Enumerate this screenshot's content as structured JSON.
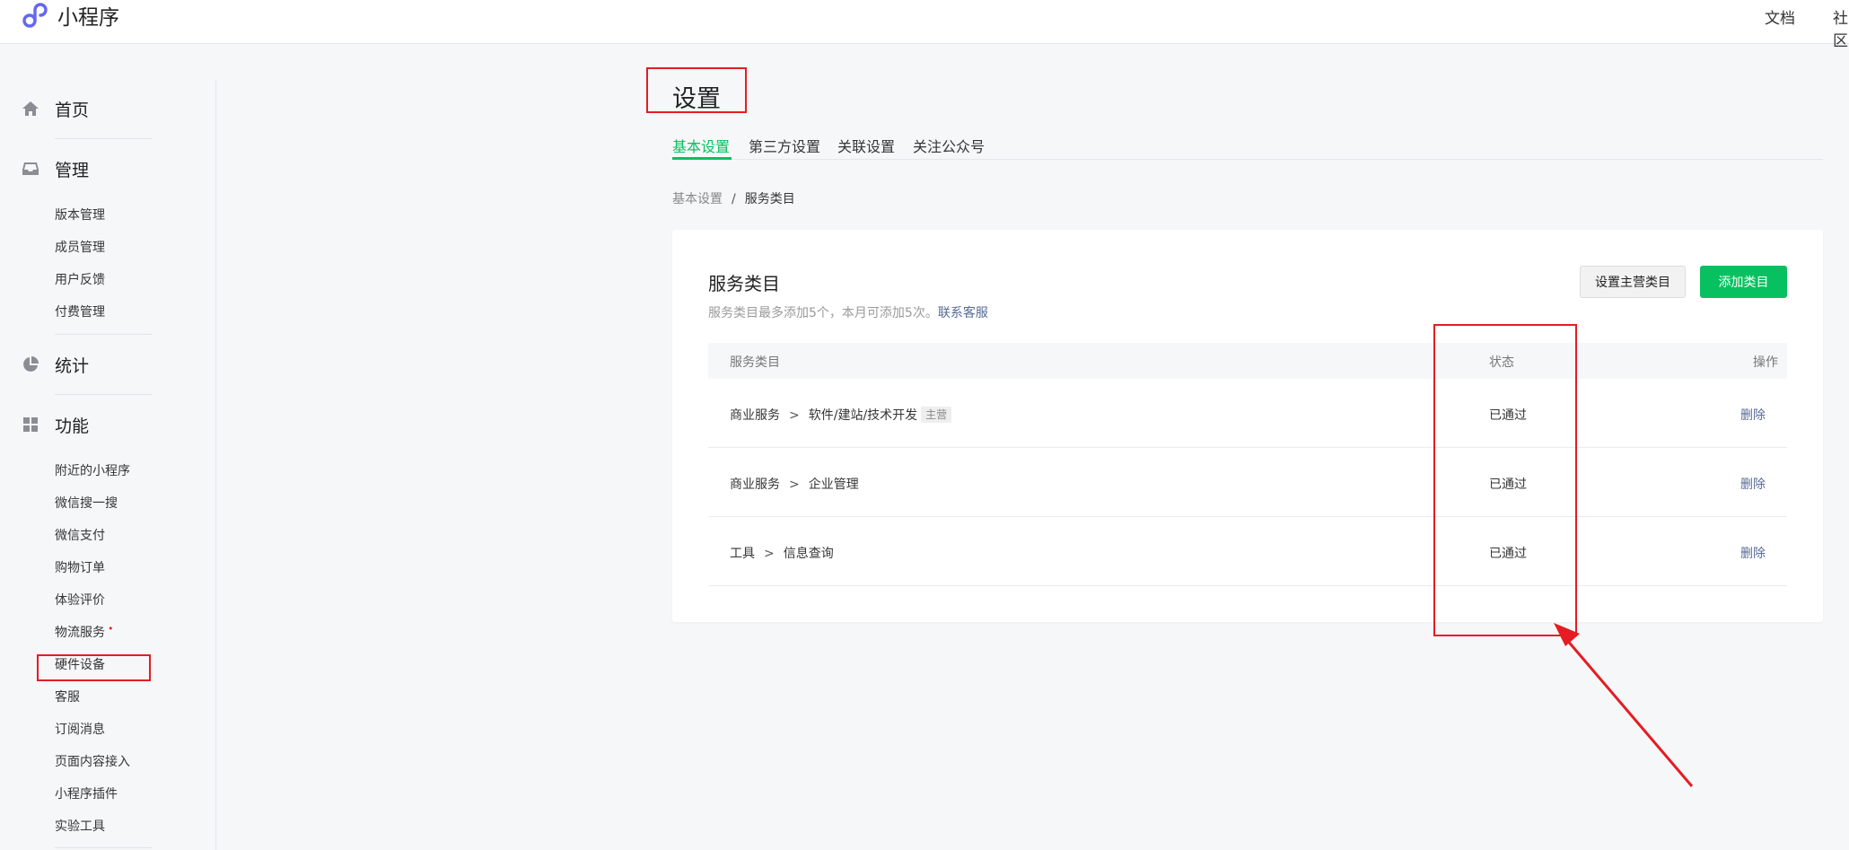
{
  "app": {
    "name": "小程序",
    "logo_icon": "mini-program-logo-icon",
    "brand_color": "#07c160",
    "link_color": "#576b95"
  },
  "topnav": {
    "docs": "文档",
    "community": "社区"
  },
  "sidebar": {
    "groups": [
      {
        "label": "首页",
        "icon": "home-icon"
      },
      {
        "label": "管理",
        "icon": "inbox-icon",
        "items": [
          "版本管理",
          "成员管理",
          "用户反馈",
          "付费管理"
        ]
      },
      {
        "label": "统计",
        "icon": "pie-chart-icon"
      },
      {
        "label": "功能",
        "icon": "grid-icon",
        "items": [
          "附近的小程序",
          "微信搜一搜",
          "微信支付",
          "购物订单",
          "体验评价",
          "物流服务",
          "硬件设备",
          "客服",
          "订阅消息",
          "页面内容接入",
          "小程序插件",
          "实验工具"
        ]
      }
    ],
    "new_dot": "•"
  },
  "page": {
    "title": "设置",
    "tabs": [
      "基本设置",
      "第三方设置",
      "关联设置",
      "关注公众号"
    ],
    "active_tab": 0,
    "breadcrumb": {
      "parent": "基本设置",
      "separator": "/",
      "current": "服务类目"
    }
  },
  "card": {
    "title": "服务类目",
    "desc": "服务类目最多添加5个，本月可添加5次。",
    "desc_link": "联系客服",
    "btn_set_main": "设置主营类目",
    "btn_add": "添加类目",
    "columns": {
      "category": "服务类目",
      "status": "状态",
      "action": "操作"
    },
    "rows": [
      {
        "cat1": "商业服务",
        "sep": ">",
        "cat2": "软件/建站/技术开发",
        "tag": "主营",
        "status": "已通过",
        "action": "删除"
      },
      {
        "cat1": "商业服务",
        "sep": ">",
        "cat2": "企业管理",
        "tag": "",
        "status": "已通过",
        "action": "删除"
      },
      {
        "cat1": "工具",
        "sep": ">",
        "cat2": "信息查询",
        "tag": "",
        "status": "已通过",
        "action": "删除"
      }
    ]
  }
}
